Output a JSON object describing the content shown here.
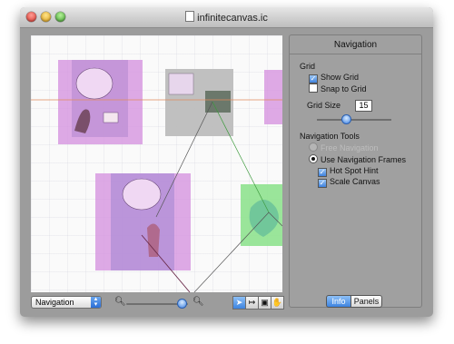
{
  "window": {
    "title": "infinitecanvas.ic"
  },
  "bottom_bar": {
    "mode_select": "Navigation",
    "zoom_level": 0.9
  },
  "panel": {
    "title": "Navigation",
    "grid": {
      "heading": "Grid",
      "show_grid": {
        "label": "Show Grid",
        "checked": true
      },
      "snap_to_grid": {
        "label": "Snap to Grid",
        "checked": false
      },
      "size_label": "Grid Size",
      "size_value": "15",
      "slider_level": 0.35
    },
    "nav_tools": {
      "heading": "Navigation Tools",
      "free_navigation": {
        "label": "Free Navigation",
        "enabled": false
      },
      "use_frames": {
        "label": "Use Navigation Frames",
        "selected": true
      },
      "hot_spot_hint": {
        "label": "Hot Spot Hint",
        "checked": true
      },
      "scale_canvas": {
        "label": "Scale Canvas",
        "checked": true
      }
    },
    "tabs": {
      "info": "Info",
      "panels": "Panels"
    }
  },
  "colors": {
    "frame_magenta": "#d08ad8",
    "frame_gray": "#b8b8b8",
    "frame_green": "#8fe28f",
    "accent": "#3d84e0"
  }
}
